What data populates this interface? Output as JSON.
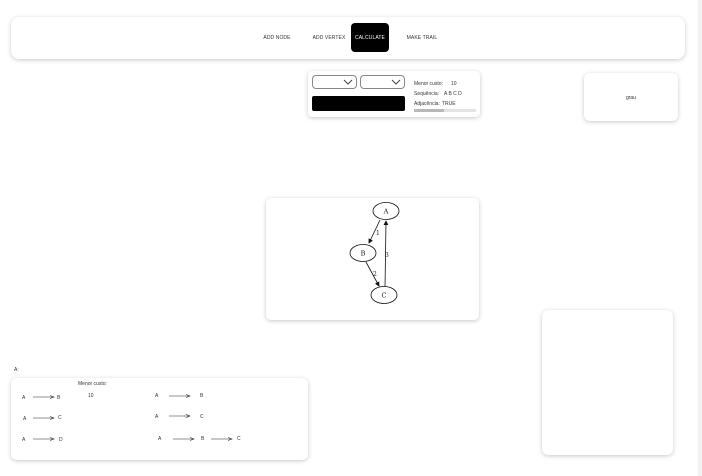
{
  "navbar": {
    "add_node": "ADD NODE",
    "add_vertex": "ADD VERTEX",
    "calculate": "CALCULATE",
    "make_trail": "MAKE TRAIL"
  },
  "controls": {
    "select_from_value": "",
    "select_to_value": "",
    "cost_label": "Menor custo:",
    "cost_value": "10",
    "sequence_label": "Sequência:",
    "sequence_value": "A B C D",
    "adjacency_label": "Adjacência:",
    "adjacency_value": "TRUE",
    "progress_fraction": 0.48
  },
  "grau": {
    "label": "grau"
  },
  "graph": {
    "nodes": [
      "A",
      "B",
      "C"
    ],
    "edges": [
      {
        "from": "A",
        "to": "B",
        "weight": "1"
      },
      {
        "from": "B",
        "to": "C",
        "weight": "2"
      },
      {
        "from": "C",
        "to": "A",
        "weight": "3"
      }
    ]
  },
  "paths": {
    "title": "A:",
    "cost_label": "Menor custo:",
    "cost_value": "10",
    "left_column": [
      [
        "A",
        "B"
      ],
      [
        "A",
        "C"
      ],
      [
        "A",
        "D"
      ]
    ],
    "right_column": [
      [
        "A",
        "B"
      ],
      [
        "A",
        "C"
      ],
      [
        "A",
        "B",
        "C"
      ]
    ]
  },
  "colors": {
    "accent": "#000000",
    "card_bg": "#ffffff",
    "progress": "#b8b8b8"
  }
}
